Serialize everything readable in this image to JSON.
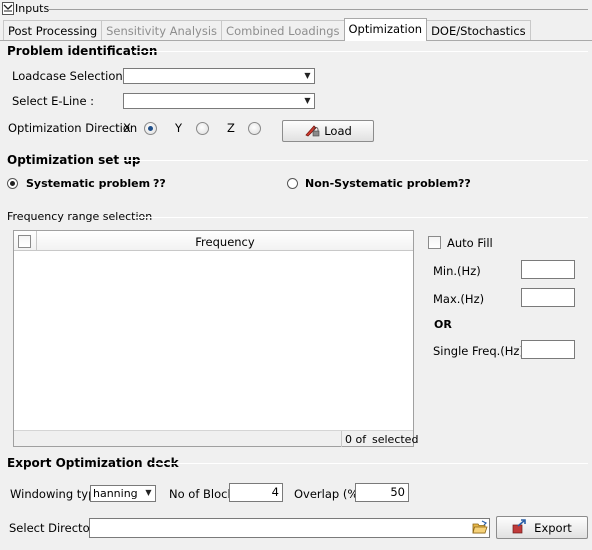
{
  "panel": {
    "title": "Inputs",
    "collapse_icon": "chevron-down-icon"
  },
  "tabs": [
    {
      "label": "Post Processing",
      "state": "normal"
    },
    {
      "label": "Sensitivity Analysis",
      "state": "disabled"
    },
    {
      "label": "Combined Loadings",
      "state": "disabled"
    },
    {
      "label": "Optimization",
      "state": "active"
    },
    {
      "label": "DOE/Stochastics",
      "state": "normal"
    }
  ],
  "problem_identification": {
    "title": "Problem identification",
    "loadcase_label": "Loadcase Selection:",
    "loadcase_value": "",
    "eline_label": "Select E-Line :",
    "eline_value": "",
    "direction_label": "Optimization Direction",
    "direction_x": "X",
    "direction_y": "Y",
    "direction_z": "Z",
    "direction_selected": "X",
    "load_button": "Load",
    "load_icon": "pencil-lock-icon"
  },
  "setup": {
    "title": "Optimization set up",
    "systematic_label": "Systematic problem",
    "systematic_help": "??",
    "nonsystematic_label": "Non-Systematic problem",
    "nonsystematic_help": "??",
    "selected": "systematic"
  },
  "frequency": {
    "title": "Frequency range selection",
    "column_header": "Frequency",
    "rows": [],
    "count_text": "0 of",
    "selected_text": "selected",
    "auto_fill_label": "Auto Fill",
    "auto_fill_checked": false,
    "min_label": "Min.(Hz)",
    "min_value": "",
    "max_label": "Max.(Hz)",
    "max_value": "",
    "or_label": "OR",
    "single_label": "Single Freq.(Hz)",
    "single_value": ""
  },
  "export": {
    "title": "Export Optimization deck",
    "windowing_label": "Windowing type",
    "windowing_value": "hanning",
    "block_label": "No of Block",
    "block_value": "4",
    "overlap_label": "Overlap (%):",
    "overlap_value": "50",
    "directory_label": "Select Directory",
    "directory_value": "",
    "folder_icon": "folder-open-icon",
    "export_button": "Export",
    "export_icon": "export-arrow-icon"
  },
  "colors": {
    "accent_radio": "#1f4f8a",
    "border": "#a0a0a0",
    "background": "#f0f0f0"
  }
}
